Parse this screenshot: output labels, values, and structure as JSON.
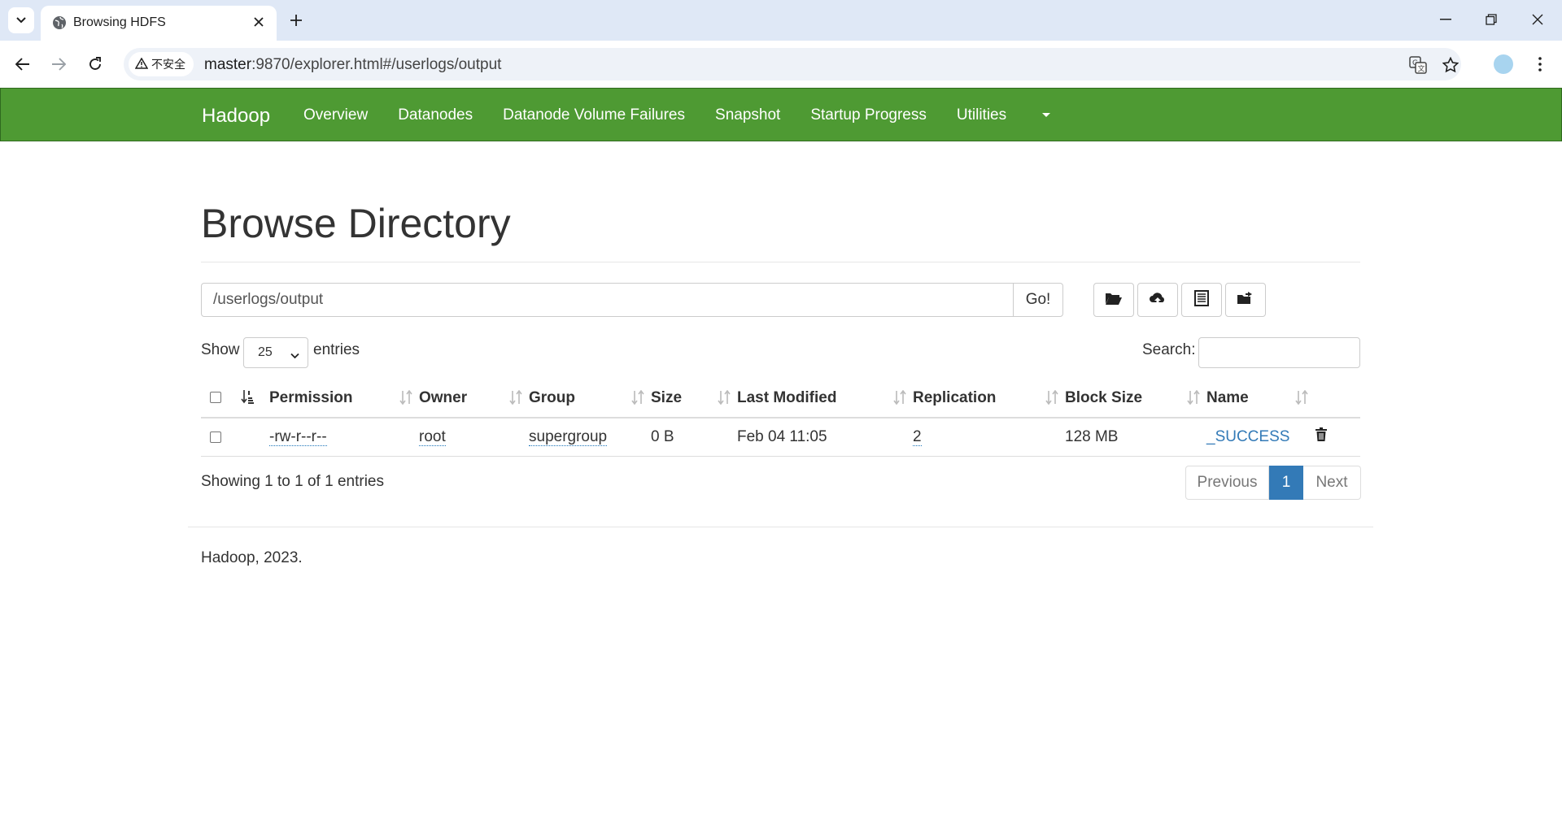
{
  "browser": {
    "tab_title": "Browsing HDFS",
    "security_label": "不安全",
    "url_host": "master",
    "url_path": ":9870/explorer.html#/userlogs/output"
  },
  "navbar": {
    "brand": "Hadoop",
    "links": [
      "Overview",
      "Datanodes",
      "Datanode Volume Failures",
      "Snapshot",
      "Startup Progress",
      "Utilities"
    ]
  },
  "page": {
    "title": "Browse Directory",
    "path_value": "/userlogs/output",
    "go_label": "Go!"
  },
  "table_controls": {
    "show_label": "Show",
    "page_length": "25",
    "entries_label": "entries",
    "search_label": "Search:"
  },
  "table": {
    "headers": [
      "Permission",
      "Owner",
      "Group",
      "Size",
      "Last Modified",
      "Replication",
      "Block Size",
      "Name"
    ],
    "rows": [
      {
        "permission": "-rw-r--r--",
        "owner": "root",
        "group": "supergroup",
        "size": "0 B",
        "last_modified": "Feb 04 11:05",
        "replication": "2",
        "block_size": "128 MB",
        "name": "_SUCCESS"
      }
    ]
  },
  "pagination": {
    "info": "Showing 1 to 1 of 1 entries",
    "previous": "Previous",
    "current": "1",
    "next": "Next"
  },
  "footer": {
    "text": "Hadoop, 2023."
  },
  "colors": {
    "navbar_bg": "#4e9a33",
    "link": "#337ab7",
    "active_page": "#337ab7"
  }
}
